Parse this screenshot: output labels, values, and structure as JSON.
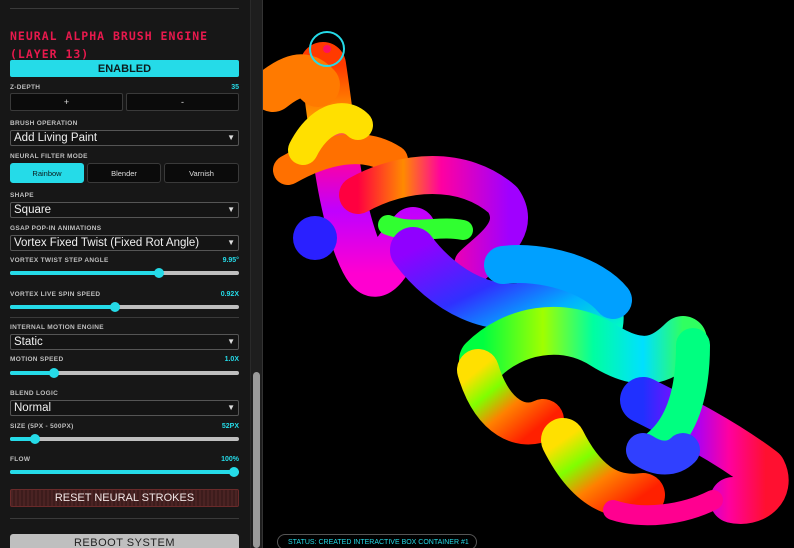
{
  "panel": {
    "title": "NEURAL ALPHA BRUSH ENGINE (LAYER 13)",
    "enabled_label": "ENABLED",
    "z_depth": {
      "label": "Z-DEPTH",
      "value": "35",
      "plus": "+",
      "minus": "-"
    },
    "brush_operation": {
      "label": "BRUSH OPERATION",
      "selected": "Add Living Paint"
    },
    "neural_filter_mode": {
      "label": "NEURAL FILTER MODE",
      "options": [
        "Rainbow",
        "Blender",
        "Varnish"
      ],
      "active": "Rainbow"
    },
    "shape": {
      "label": "SHAPE",
      "selected": "Square"
    },
    "gsap_animations": {
      "label": "GSAP POP-IN ANIMATIONS",
      "selected": "Vortex Fixed Twist (Fixed Rot Angle)"
    },
    "vortex_twist": {
      "label": "VORTEX TWIST STEP ANGLE",
      "value": "9.95°",
      "fraction": 0.65
    },
    "vortex_spin": {
      "label": "VORTEX LIVE SPIN SPEED",
      "value": "0.92X",
      "fraction": 0.46
    },
    "motion_engine": {
      "label": "INTERNAL MOTION ENGINE",
      "selected": "Static"
    },
    "motion_speed": {
      "label": "MOTION SPEED",
      "value": "1.0X",
      "fraction": 0.19
    },
    "blend_logic": {
      "label": "BLEND LOGIC",
      "selected": "Normal"
    },
    "size": {
      "label": "SIZE (5PX - 500PX)",
      "value": "52PX",
      "fraction": 0.11
    },
    "flow": {
      "label": "FLOW",
      "value": "100%",
      "fraction": 1.0
    },
    "reset_label": "RESET NEURAL STROKES",
    "reboot_label": "REBOOT SYSTEM"
  },
  "status": "STATUS: CREATED INTERACTIVE BOX CONTAINER #1",
  "colors": {
    "accent": "#25dbe8",
    "title": "#e8194d",
    "panel_bg": "#171717"
  }
}
